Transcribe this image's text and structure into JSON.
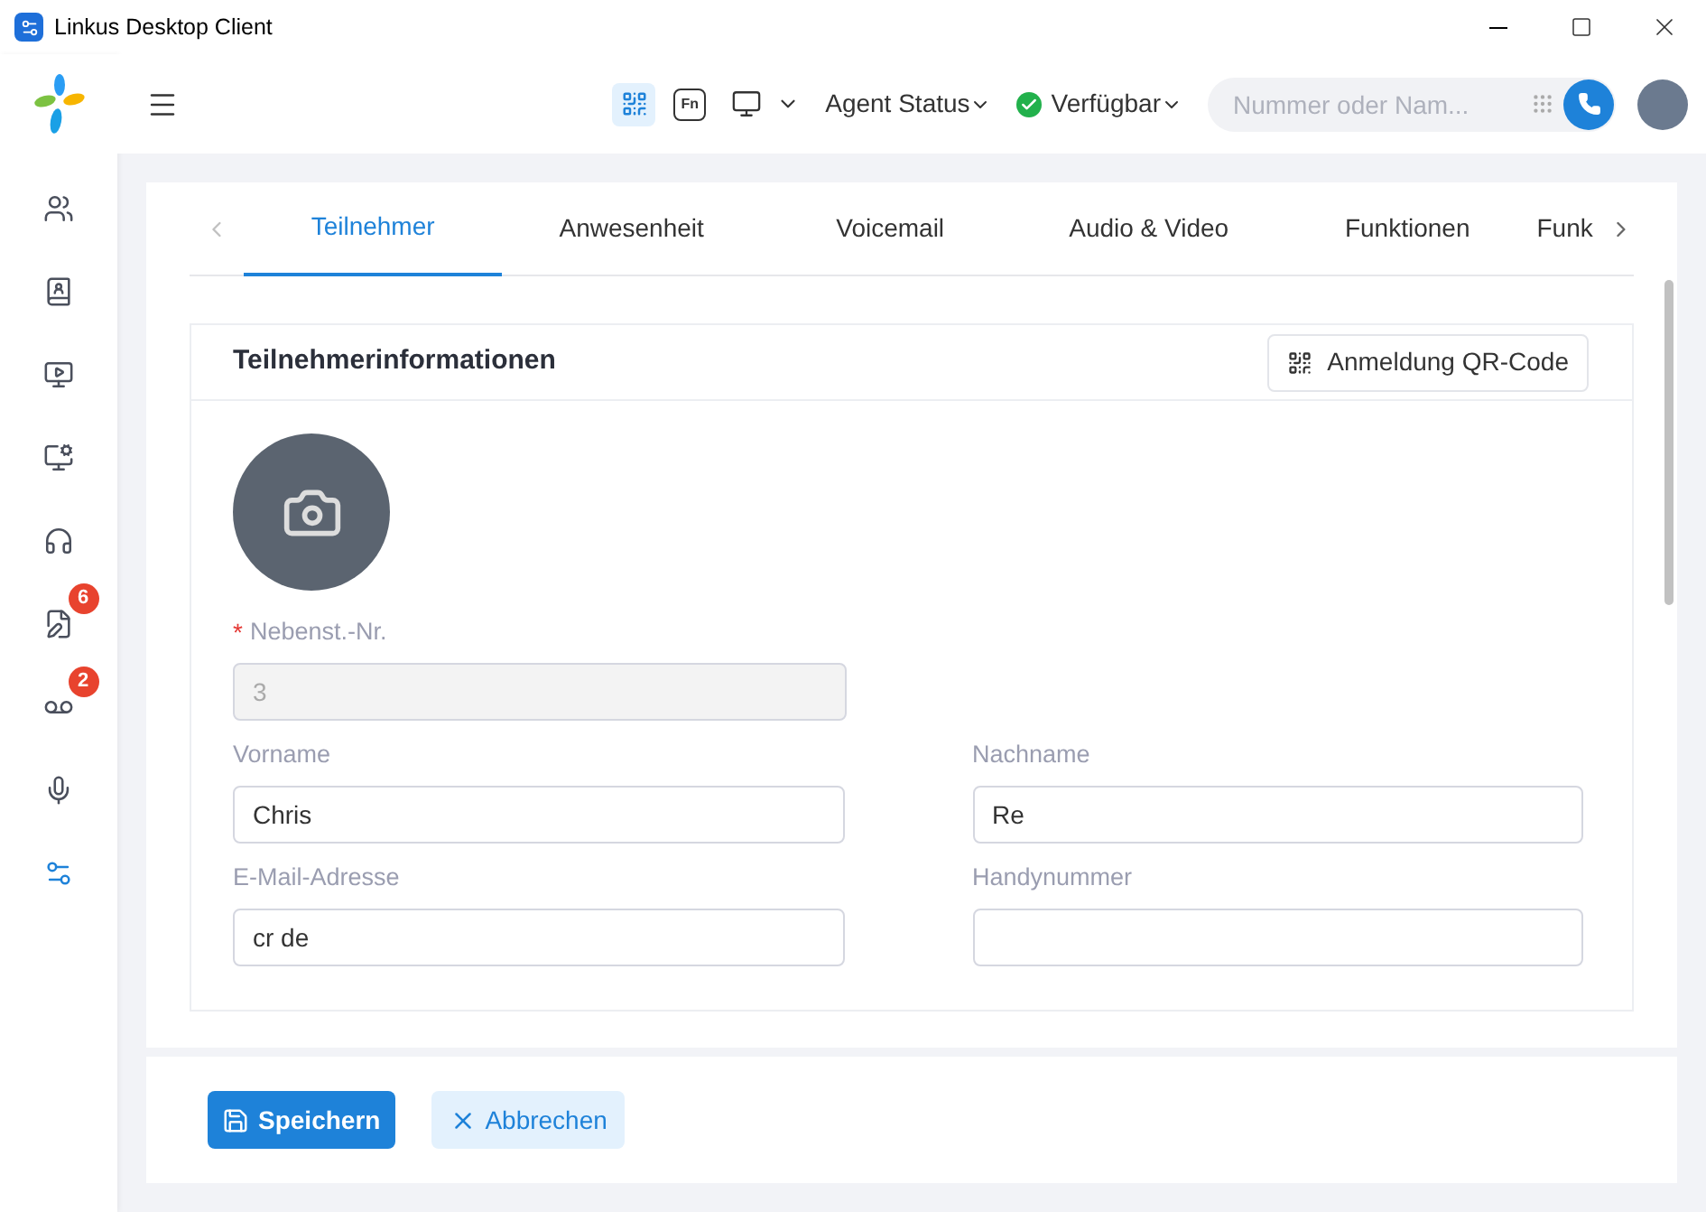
{
  "window": {
    "title": "Linkus Desktop Client"
  },
  "topbar": {
    "function_key": "Fn",
    "agent_status": "Agent Status",
    "presence": "Verfügbar",
    "search": {
      "placeholder": "Nummer oder Nam..."
    }
  },
  "sidebar": {
    "items": [
      {
        "selected": false
      },
      {
        "selected": false
      },
      {
        "selected": false
      },
      {
        "selected": false
      },
      {
        "selected": false
      },
      {
        "selected": false,
        "badge": "6"
      },
      {
        "selected": false,
        "badge": "2"
      },
      {
        "selected": false
      },
      {
        "selected": true
      }
    ]
  },
  "tabs": [
    {
      "label": "Teilnehmer",
      "selected": true
    },
    {
      "label": "Anwesenheit",
      "selected": false
    },
    {
      "label": "Voicemail",
      "selected": false
    },
    {
      "label": "Audio & Video",
      "selected": false
    },
    {
      "label": "Funktionen",
      "selected": false
    },
    {
      "label": "Funk",
      "selected": false
    }
  ],
  "section": {
    "title": "Teilnehmerinformationen",
    "qr_button": "Anmeldung QR-Code",
    "fields": [
      {
        "required_mark": "*",
        "label": "Nebenst.-Nr.",
        "value": "3",
        "disabled": true
      },
      {
        "label": "Vorname",
        "value": "Chris",
        "disabled": false
      },
      {
        "label": "Nachname",
        "value": "Re",
        "disabled": false
      },
      {
        "label": "E-Mail-Adresse",
        "value": "cr de",
        "disabled": false
      },
      {
        "label": "Handynummer",
        "disabled": false
      }
    ]
  },
  "buttons": {
    "save": "Speichern",
    "cancel": "Abbrechen"
  }
}
